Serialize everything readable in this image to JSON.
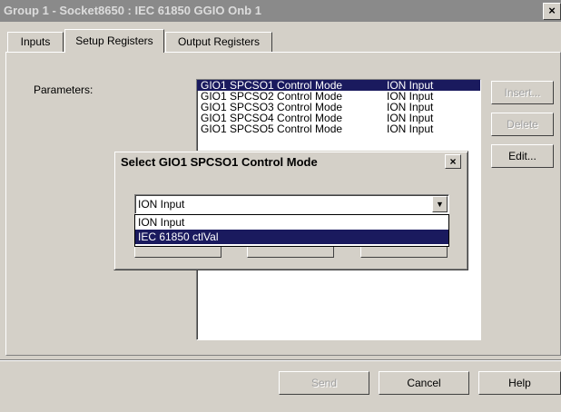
{
  "window": {
    "title": "Group 1 - Socket8650 : IEC 61850 GGIO Onb 1",
    "close_label": "×"
  },
  "tabs": [
    {
      "label": "Inputs"
    },
    {
      "label": "Setup Registers"
    },
    {
      "label": "Output Registers"
    }
  ],
  "setup": {
    "parameters_label": "Parameters:",
    "rows": [
      {
        "name": "GIO1 SPCSO1 Control Mode",
        "value": "ION Input"
      },
      {
        "name": "GIO1 SPCSO2 Control Mode",
        "value": "ION Input"
      },
      {
        "name": "GIO1 SPCSO3 Control Mode",
        "value": "ION Input"
      },
      {
        "name": "GIO1 SPCSO4 Control Mode",
        "value": "ION Input"
      },
      {
        "name": "GIO1 SPCSO5 Control Mode",
        "value": "ION Input"
      }
    ],
    "buttons": {
      "insert": "Insert...",
      "delete": "Delete",
      "edit": "Edit..."
    }
  },
  "footer": {
    "send": "Send",
    "cancel": "Cancel",
    "help": "Help"
  },
  "dialog": {
    "title": "Select GIO1 SPCSO1 Control Mode",
    "close_label": "×",
    "selected": "ION Input",
    "options": [
      "ION Input",
      "IEC 61850 ctlVal"
    ]
  },
  "icons": {
    "dropdown_arrow": "chevron-down-icon",
    "close": "close-icon"
  }
}
